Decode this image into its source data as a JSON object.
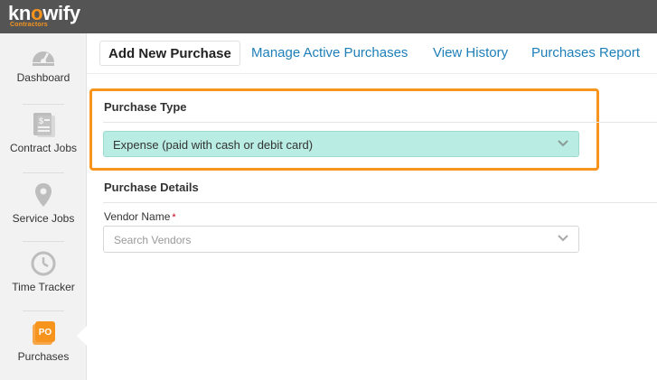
{
  "app": {
    "logo_text_pre": "kn",
    "logo_text_o": "o",
    "logo_text_post": "wify",
    "logo_subtitle": "Contractors",
    "brand_color": "#f7941d",
    "topbar_color": "#545454"
  },
  "sidebar": {
    "items": [
      {
        "label": "Dashboard",
        "icon": "speedometer-icon",
        "active": false
      },
      {
        "label": "Contract Jobs",
        "icon": "contract-document-icon",
        "active": false
      },
      {
        "label": "Service Jobs",
        "icon": "map-pin-icon",
        "active": false
      },
      {
        "label": "Time Tracker",
        "icon": "clock-icon",
        "active": false
      },
      {
        "label": "Purchases",
        "icon": "purchase-order-icon",
        "icon_text": "PO",
        "active": true
      }
    ]
  },
  "tabs": [
    {
      "label": "Add New Purchase",
      "active": true
    },
    {
      "label": "Manage Active Purchases",
      "active": false
    },
    {
      "label": "View History",
      "active": false
    },
    {
      "label": "Purchases Report",
      "active": false
    }
  ],
  "purchase_type": {
    "title": "Purchase Type",
    "selected": "Expense (paid with cash or debit card)",
    "select_color": "#b9ede3",
    "highlight_color": "#f7941d"
  },
  "purchase_details": {
    "title": "Purchase Details",
    "vendor_label": "Vendor Name",
    "required_marker": "*",
    "vendor_placeholder": "Search Vendors"
  }
}
